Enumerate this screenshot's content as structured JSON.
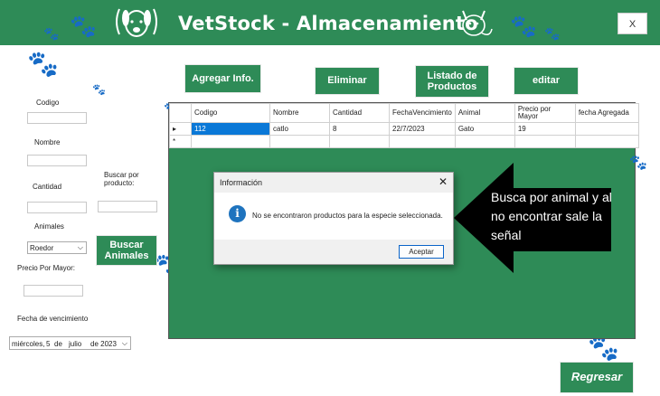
{
  "header": {
    "title": "VetStock - Almacenamiento",
    "close_label": "X",
    "bg_color": "#2e8b57"
  },
  "form": {
    "codigo_label": "Codigo",
    "nombre_label": "Nombre",
    "cantidad_label": "Cantidad",
    "buscar_label": "Buscar por producto:",
    "animales_label": "Animales",
    "animal_select_value": "Roedor",
    "precio_label": "Precio Por Mayor:",
    "vencimiento_label": "Fecha de vencimiento",
    "date_value": {
      "weekday": "miércoles,",
      "day": "5",
      "de1": "de",
      "month": "julio",
      "year": "de 2023"
    }
  },
  "buttons": {
    "agregar": "Agregar Info.",
    "eliminar": "Eliminar",
    "listado": "Listado de Productos",
    "editar": "editar",
    "buscar_animales": "Buscar Animales",
    "regresar": "Regresar"
  },
  "table": {
    "columns": [
      "Codigo",
      "Nombre",
      "Cantidad",
      "FechaVencimiento",
      "Animal",
      "Precio por Mayor",
      "fecha Agregada"
    ],
    "rows": [
      [
        "112",
        "catlo",
        "8",
        "22/7/2023",
        "Gato",
        "19",
        ""
      ]
    ],
    "row_marker": "▸",
    "new_row_marker": "*"
  },
  "dialog": {
    "title": "Información",
    "close": "✕",
    "icon": "info-icon",
    "message": "No se encontraron productos para la especie seleccionada.",
    "ok_label": "Aceptar"
  },
  "callout": {
    "text": "Busca por animal y al no encontrar sale la señal"
  },
  "icons": {
    "paw": "paw-icon",
    "dog": "dog-icon",
    "cat": "cat-icon"
  }
}
